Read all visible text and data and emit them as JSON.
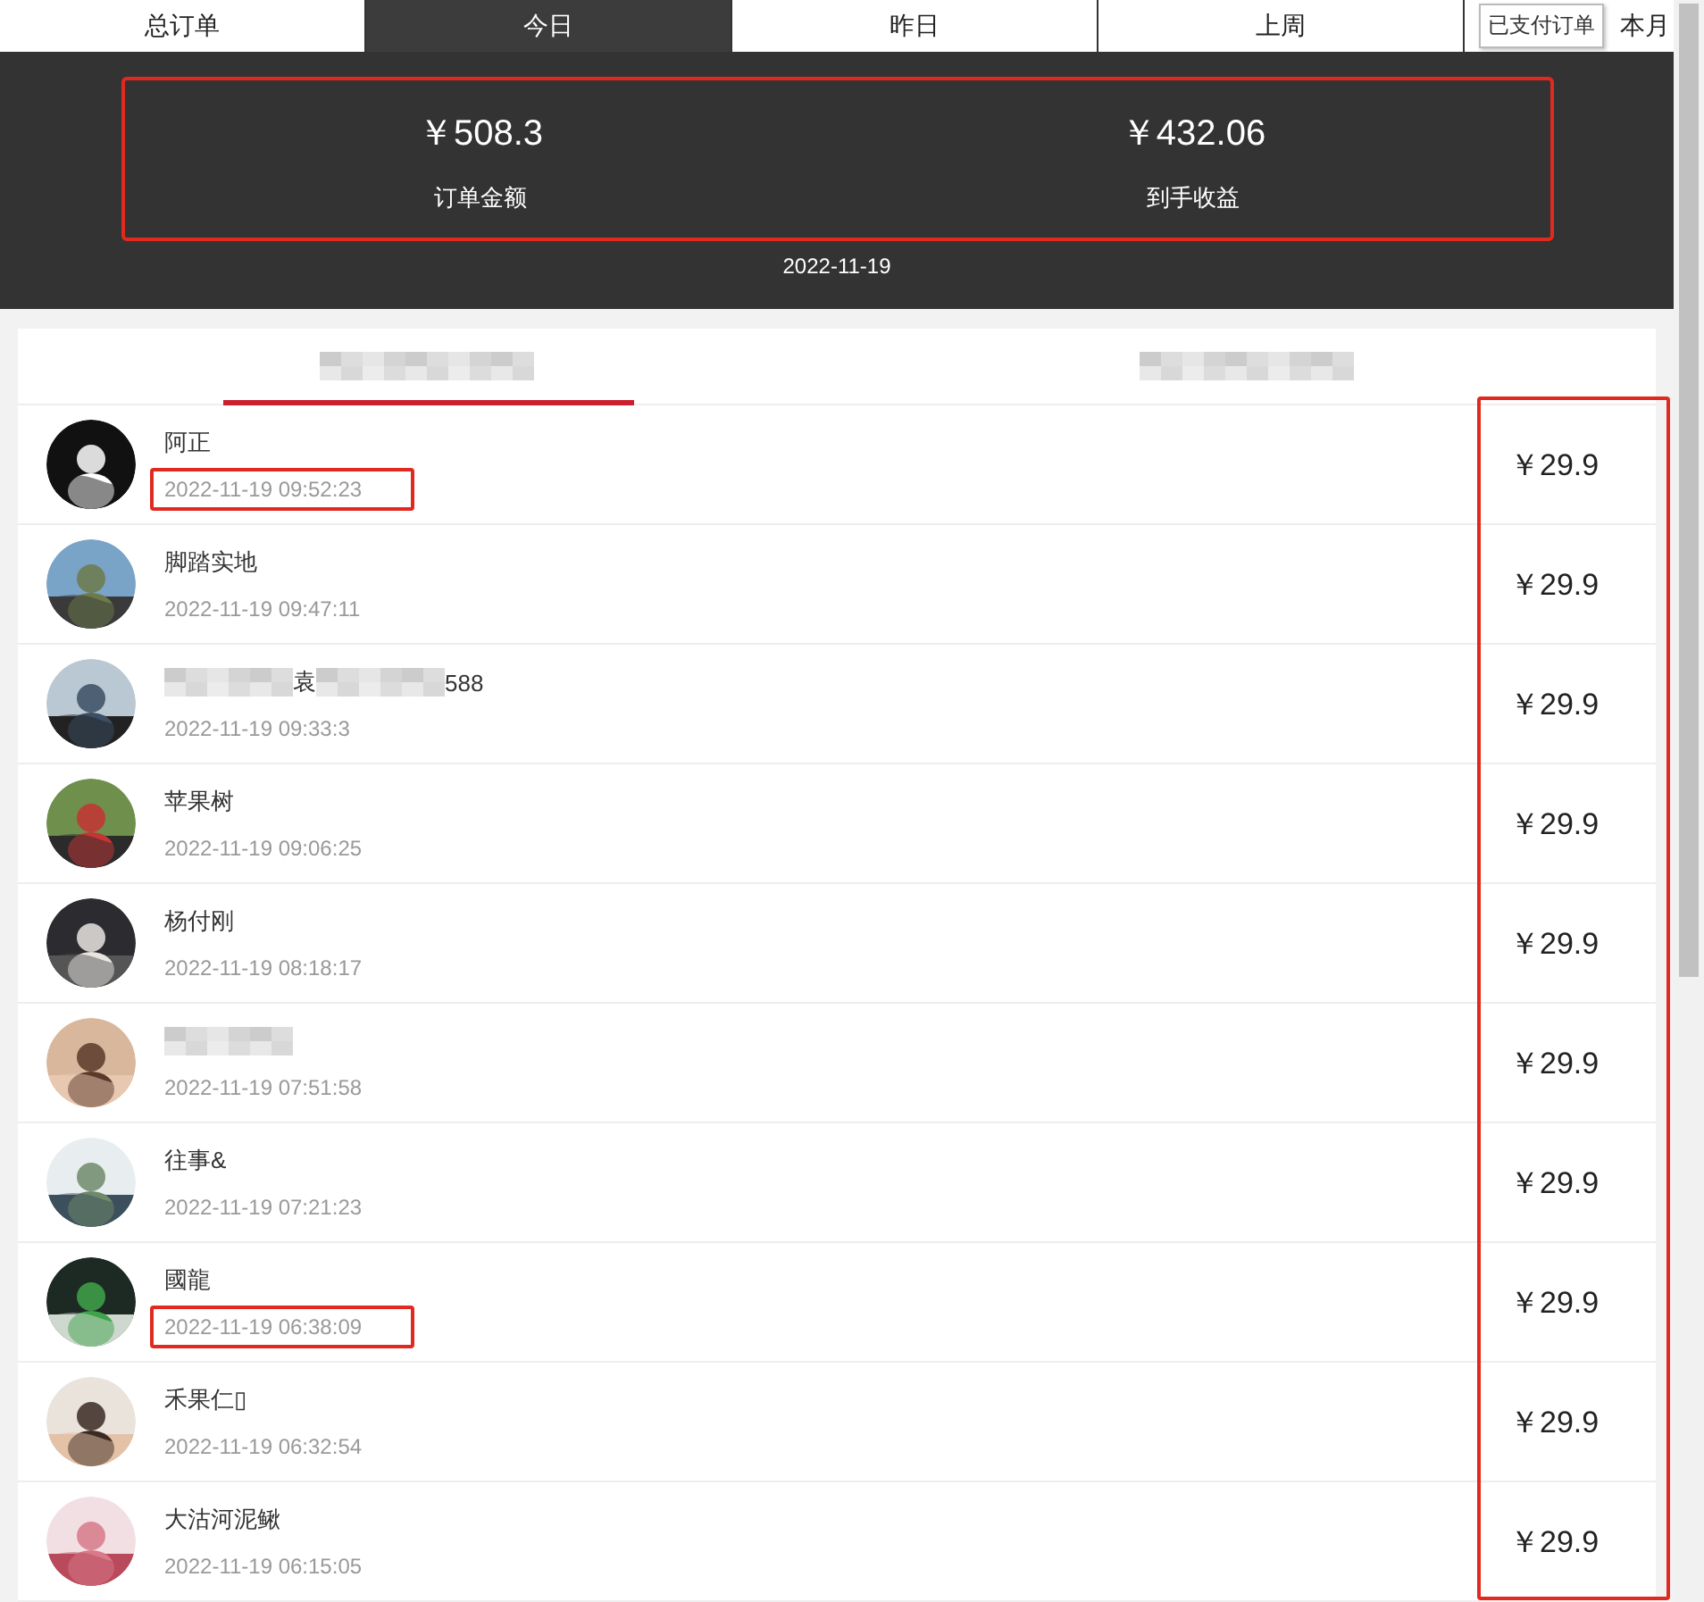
{
  "period_tabs": [
    {
      "label": "总订单",
      "selected": false
    },
    {
      "label": "今日",
      "selected": true
    },
    {
      "label": "昨日",
      "selected": false
    },
    {
      "label": "上周",
      "selected": false
    },
    {
      "label": "本月",
      "selected": false
    }
  ],
  "tooltip": "已支付订单",
  "stats": {
    "outlined": true,
    "items": [
      {
        "value": "￥508.3",
        "label": "订单金额"
      },
      {
        "value": "￥432.06",
        "label": "到手收益"
      }
    ]
  },
  "date": "2022-11-19",
  "sub_tabs": [
    {
      "selected": true
    },
    {
      "selected": false
    }
  ],
  "price_column_outlined": true,
  "orders": [
    {
      "avatar": {
        "kind": "picture"
      },
      "name": [
        {
          "kind": "text",
          "text": "阿正"
        }
      ],
      "time": "2022-11-19 09:52:23",
      "time_outlined": true,
      "price": "￥29.9"
    },
    {
      "avatar": {
        "kind": "picture"
      },
      "name": [
        {
          "kind": "text",
          "text": "脚踏实地"
        }
      ],
      "time": "2022-11-19 09:47:11",
      "time_outlined": false,
      "price": "￥29.9"
    },
    {
      "avatar": {
        "kind": "picture"
      },
      "name": [
        {
          "kind": "blur"
        },
        {
          "kind": "text",
          "text": "袁"
        },
        {
          "kind": "blur"
        },
        {
          "kind": "text",
          "text": "588"
        }
      ],
      "time": "2022-11-19 09:33:3",
      "time_outlined": false,
      "price": "￥29.9"
    },
    {
      "avatar": {
        "kind": "picture"
      },
      "name": [
        {
          "kind": "text",
          "text": "苹果树"
        }
      ],
      "time": "2022-11-19 09:06:25",
      "time_outlined": false,
      "price": "￥29.9"
    },
    {
      "avatar": {
        "kind": "picture"
      },
      "name": [
        {
          "kind": "text",
          "text": "杨付刚"
        }
      ],
      "time": "2022-11-19 08:18:17",
      "time_outlined": false,
      "price": "￥29.9"
    },
    {
      "avatar": {
        "kind": "picture"
      },
      "name": [
        {
          "kind": "blur"
        }
      ],
      "time": "2022-11-19 07:51:58",
      "time_outlined": false,
      "price": "￥29.9"
    },
    {
      "avatar": {
        "kind": "picture"
      },
      "name": [
        {
          "kind": "text",
          "text": "往事&"
        }
      ],
      "time": "2022-11-19 07:21:23",
      "time_outlined": false,
      "price": "￥29.9"
    },
    {
      "avatar": {
        "kind": "picture"
      },
      "name": [
        {
          "kind": "text",
          "text": "國龍"
        }
      ],
      "time": "2022-11-19 06:38:09",
      "time_outlined": true,
      "price": "￥29.9"
    },
    {
      "avatar": {
        "kind": "picture"
      },
      "name": [
        {
          "kind": "text",
          "text": "禾果仁▯"
        }
      ],
      "time": "2022-11-19 06:32:54",
      "time_outlined": false,
      "price": "￥29.9"
    },
    {
      "avatar": {
        "kind": "picture"
      },
      "name": [
        {
          "kind": "text",
          "text": "大沽河泥鳅"
        }
      ],
      "time": "2022-11-19 06:15:05",
      "time_outlined": false,
      "price": "￥29.9"
    }
  ]
}
